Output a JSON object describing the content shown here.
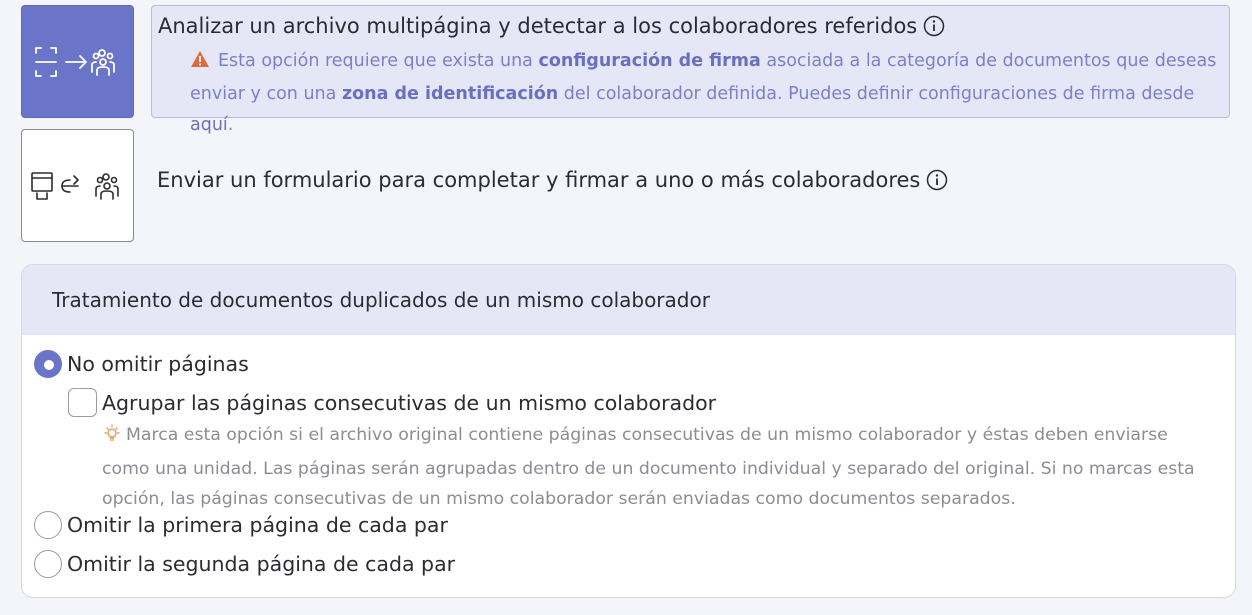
{
  "options": {
    "analyze": {
      "title": "Analizar un archivo multipágina y detectar a los colaboradores referidos",
      "warning": {
        "text_1": "Esta opción requiere que exista una ",
        "bold_1": "configuración de firma",
        "text_2": " asociada a la categoría de documentos que deseas enviar y con una ",
        "bold_2": "zona de identificación",
        "text_3": " del colaborador definida. Puedes definir configuraciones de firma desde ",
        "link": "aquí",
        "text_4": "."
      }
    },
    "form": {
      "title": "Enviar un formulario para completar y firmar a uno o más colaboradores"
    }
  },
  "duplicates": {
    "header": "Tratamiento de documentos duplicados de un mismo colaborador",
    "no_omit_label": "No omitir páginas",
    "group_label": "Agrupar las páginas consecutivas de un mismo colaborador",
    "group_hint": "Marca esta opción si el archivo original contiene páginas consecutivas de un mismo colaborador y éstas deben enviarse como una unidad. Las páginas serán agrupadas dentro de un documento individual y separado del original. Si no marcas esta opción, las páginas consecutivas de un mismo colaborador serán enviadas como documentos separados.",
    "omit_first_label": "Omitir la primera página de cada par",
    "omit_second_label": "Omitir la segunda página de cada par",
    "selected": "no_omit",
    "group_checked": false
  },
  "colors": {
    "accent": "#6a74c9",
    "panel_bg": "#e5e6f6",
    "warning_icon": "#e06a3a",
    "hint_icon": "#e8944a"
  },
  "icons": [
    "scan-icon",
    "arrow-right-icon",
    "people-group-icon",
    "form-icon",
    "share-arrow-icon",
    "info-icon",
    "warning-icon",
    "lightbulb-icon"
  ]
}
